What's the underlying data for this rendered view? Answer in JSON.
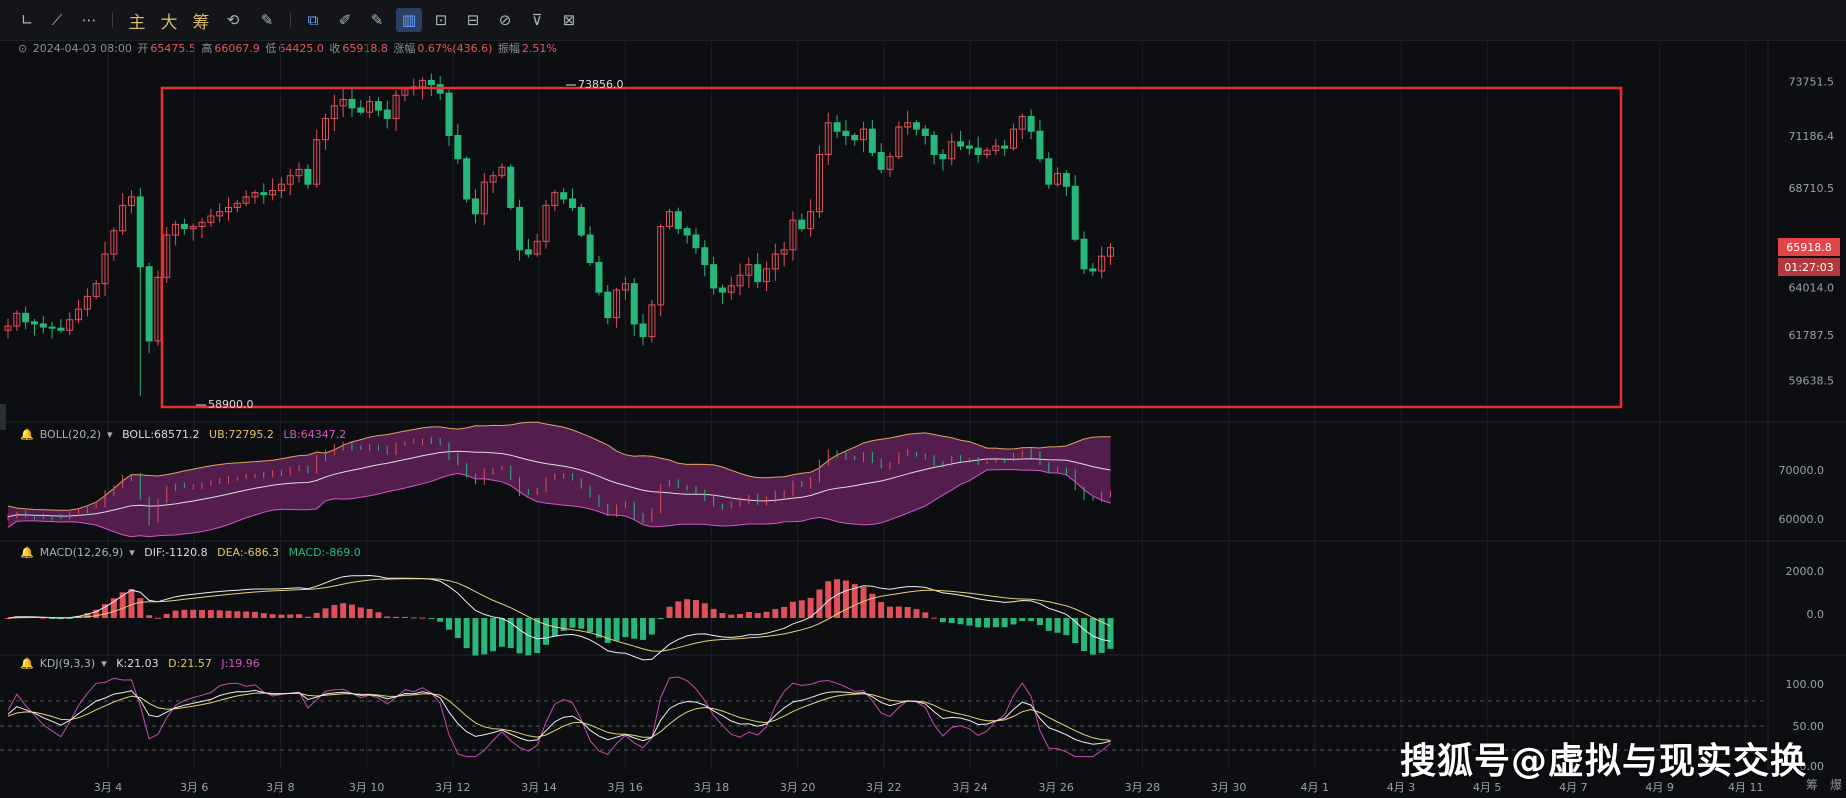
{
  "toolbar": {
    "tools": [
      {
        "name": "trend-line-icon",
        "glyph": "⟋"
      },
      {
        "name": "ray-line-icon",
        "glyph": "╱"
      },
      {
        "name": "more-icon",
        "glyph": "⋯"
      }
    ],
    "cn_buttons": [
      "主",
      "大",
      "筹"
    ],
    "right_tools": [
      {
        "name": "snapshot-icon",
        "glyph": "⧉"
      },
      {
        "name": "eraser-brush-icon",
        "glyph": "✎"
      },
      {
        "name": "box-icon",
        "glyph": "⬚"
      },
      {
        "name": "ruler-icon",
        "glyph": "⟂"
      },
      {
        "name": "pencil-icon",
        "glyph": "✐"
      },
      {
        "name": "candle-layout-icon",
        "glyph": "▥"
      },
      {
        "name": "lock-icon",
        "glyph": "⌂"
      },
      {
        "name": "note-icon",
        "glyph": "✎"
      },
      {
        "name": "magnet-icon",
        "glyph": "∩"
      },
      {
        "name": "filter-icon",
        "glyph": "⏷"
      },
      {
        "name": "trash-icon",
        "glyph": "🗑"
      }
    ]
  },
  "ohlc": {
    "date": "2024-04-03 08:00",
    "open_label": "开",
    "open": "65475.5",
    "high_label": "高",
    "high": "66067.9",
    "low_label": "低",
    "low": "64425.0",
    "close_label": "收",
    "close": "65918.8",
    "change_label": "涨幅",
    "change": "0.67%(436.6)",
    "amp_label": "振幅",
    "amp": "2.51%"
  },
  "price_axis": [
    "73751.5",
    "71186.4",
    "68710.5",
    "66??? ",
    "64014.0",
    "61787.5",
    "59638.5"
  ],
  "price_tag": "65918.8",
  "time_tag": "01:27:03",
  "annotations": {
    "high": "73856.0",
    "low": "58900.0"
  },
  "boll": {
    "label": "BOLL(20,2)",
    "mid": "BOLL:68571.2",
    "ub": "UB:72795.2",
    "lb": "LB:64347.2",
    "axis": [
      "70000.0",
      "60000.0"
    ]
  },
  "macd": {
    "label": "MACD(12,26,9)",
    "dif": "DIF:-1120.8",
    "dea": "DEA:-686.3",
    "macd": "MACD:-869.0",
    "axis": [
      "2000.0",
      "0.0"
    ]
  },
  "kdj": {
    "label": "KDJ(9,3,3)",
    "k": "K:21.03",
    "d": "D:21.57",
    "j": "J:19.96",
    "axis": [
      "100.00",
      "50.00",
      "0.00"
    ]
  },
  "x_axis": [
    "3月 4",
    "3月 6",
    "3月 8",
    "3月 10",
    "3月 12",
    "3月 14",
    "3月 16",
    "3月 18",
    "3月 20",
    "3月 22",
    "3月 24",
    "3月 26",
    "3月 28",
    "3月 30",
    "4月 1",
    "4月 3",
    "4月 5",
    "4月 7",
    "4月 9",
    "4月 11"
  ],
  "corner": {
    "a": "筹",
    "b": "爆"
  },
  "watermark": "搜狐号@虚拟与现实交换",
  "chart_data": {
    "type": "candlestick",
    "ylim": [
      58000,
      75000
    ],
    "closes": [
      62200,
      62800,
      62400,
      62300,
      62150,
      62100,
      62000,
      62500,
      63000,
      63600,
      64200,
      65600,
      66700,
      67900,
      68300,
      65000,
      61500,
      64500,
      66500,
      67000,
      66800,
      66900,
      67100,
      67400,
      67600,
      67800,
      68000,
      68300,
      68500,
      68400,
      68600,
      68900,
      69300,
      69600,
      68900,
      71000,
      72000,
      72600,
      72900,
      72500,
      72300,
      72800,
      72400,
      72000,
      73100,
      73400,
      73500,
      73800,
      73600,
      73200,
      71200,
      70100,
      68200,
      67500,
      69000,
      69300,
      69700,
      67800,
      65800,
      65600,
      66200,
      67900,
      68500,
      68200,
      67800,
      66500,
      65200,
      63800,
      62600,
      63900,
      64200,
      62300,
      61700,
      63200,
      66900,
      67600,
      66800,
      66500,
      65900,
      65100,
      64000,
      63800,
      64100,
      64600,
      65100,
      64300,
      64900,
      65600,
      65800,
      67200,
      66800,
      67600,
      70300,
      71800,
      71400,
      71200,
      71000,
      71500,
      70400,
      69600,
      70200,
      71600,
      71800,
      71500,
      71200,
      70300,
      70100,
      70900,
      70700,
      70600,
      70300,
      70500,
      70700,
      70600,
      71500,
      72100,
      71400,
      70100,
      68900,
      69400,
      68800,
      66300,
      64900,
      64800,
      65500,
      65900
    ]
  }
}
